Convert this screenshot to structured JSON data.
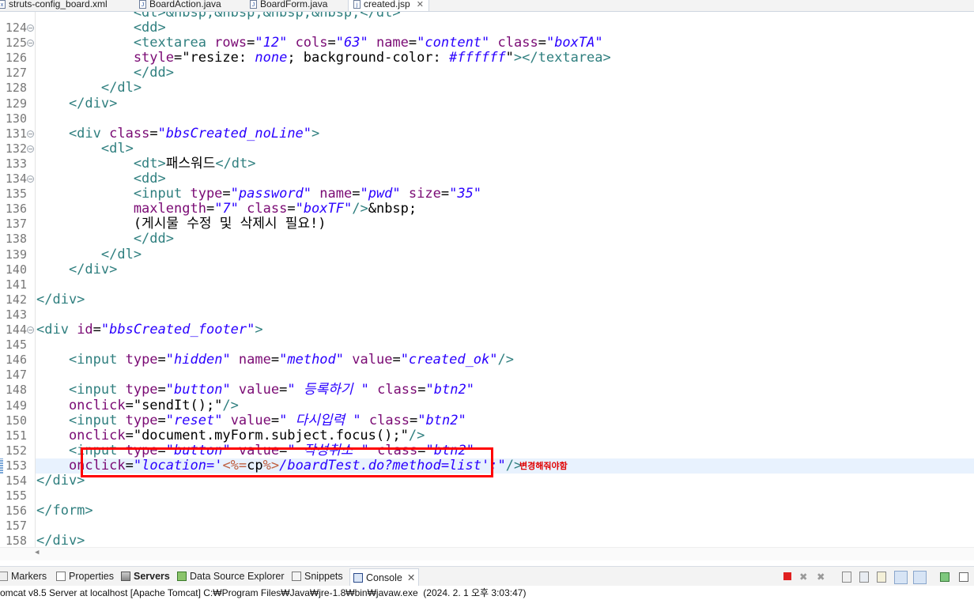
{
  "tabs": [
    {
      "label": "struts-config_board.xml",
      "icon": "xml-file-icon"
    },
    {
      "label": "BoardAction.java",
      "icon": "java-file-icon"
    },
    {
      "label": "BoardForm.java",
      "icon": "java-file-icon"
    },
    {
      "label": "created.jsp",
      "icon": "jsp-file-icon",
      "active": true
    }
  ],
  "editor": {
    "partial_top_line": "<dt>&nbsp;&nbsp;&nbsp;&nbsp;</dt>",
    "line_numbers": [
      "124",
      "125",
      "126",
      "127",
      "128",
      "129",
      "130",
      "131",
      "132",
      "133",
      "134",
      "135",
      "136",
      "137",
      "138",
      "139",
      "140",
      "141",
      "142",
      "143",
      "144",
      "145",
      "146",
      "147",
      "148",
      "149",
      "150",
      "151",
      "152",
      "153",
      "154",
      "155",
      "156",
      "157",
      "158"
    ],
    "lines": [
      {
        "n": "124",
        "t": [
          [
            "tg",
            "            <dd>"
          ]
        ]
      },
      {
        "n": "125",
        "t": [
          [
            "tg",
            "            <textarea "
          ],
          [
            "at",
            "rows"
          ],
          [
            "tx",
            "="
          ],
          [
            "sv",
            "\"12\""
          ],
          [
            "at",
            " cols"
          ],
          [
            "tx",
            "="
          ],
          [
            "sv",
            "\"63\""
          ],
          [
            "at",
            " name"
          ],
          [
            "tx",
            "="
          ],
          [
            "sv",
            "\"content\""
          ],
          [
            "at",
            " class"
          ],
          [
            "tx",
            "="
          ],
          [
            "sv",
            "\"boxTA\""
          ]
        ]
      },
      {
        "n": "126",
        "t": [
          [
            "at",
            "            style"
          ],
          [
            "tx",
            "=\"resize: "
          ],
          [
            "sv",
            "none"
          ],
          [
            "tx",
            "; background-color: "
          ],
          [
            "sv",
            "#ffffff"
          ],
          [
            "tx",
            "\""
          ],
          [
            "tg",
            "></textarea>"
          ]
        ]
      },
      {
        "n": "127",
        "t": [
          [
            "tg",
            "            </dd>"
          ]
        ]
      },
      {
        "n": "128",
        "t": [
          [
            "tg",
            "        </dl>"
          ]
        ]
      },
      {
        "n": "129",
        "t": [
          [
            "tg",
            "    </div>"
          ]
        ]
      },
      {
        "n": "130",
        "t": []
      },
      {
        "n": "131",
        "t": [
          [
            "tg",
            "    <div "
          ],
          [
            "at",
            "class"
          ],
          [
            "tx",
            "="
          ],
          [
            "sv",
            "\"bbsCreated_noLine\""
          ],
          [
            "tg",
            ">"
          ]
        ]
      },
      {
        "n": "132",
        "t": [
          [
            "tg",
            "        <dl>"
          ]
        ]
      },
      {
        "n": "133",
        "t": [
          [
            "tg",
            "            <dt>"
          ],
          [
            "tx",
            "패스워드"
          ],
          [
            "tg",
            "</dt>"
          ]
        ]
      },
      {
        "n": "134",
        "t": [
          [
            "tg",
            "            <dd>"
          ]
        ]
      },
      {
        "n": "135",
        "t": [
          [
            "tg",
            "            <input "
          ],
          [
            "at",
            "type"
          ],
          [
            "tx",
            "="
          ],
          [
            "sv",
            "\"password\""
          ],
          [
            "at",
            " name"
          ],
          [
            "tx",
            "="
          ],
          [
            "sv",
            "\"pwd\""
          ],
          [
            "at",
            " size"
          ],
          [
            "tx",
            "="
          ],
          [
            "sv",
            "\"35\""
          ]
        ]
      },
      {
        "n": "136",
        "t": [
          [
            "at",
            "            maxlength"
          ],
          [
            "tx",
            "="
          ],
          [
            "sv",
            "\"7\""
          ],
          [
            "at",
            " class"
          ],
          [
            "tx",
            "="
          ],
          [
            "sv",
            "\"boxTF\""
          ],
          [
            "tg",
            "/>"
          ],
          [
            "tx",
            "&nbsp;"
          ]
        ]
      },
      {
        "n": "137",
        "t": [
          [
            "tx",
            "            (게시물 수정 및 삭제시 필요!)"
          ]
        ]
      },
      {
        "n": "138",
        "t": [
          [
            "tg",
            "            </dd>"
          ]
        ]
      },
      {
        "n": "139",
        "t": [
          [
            "tg",
            "        </dl>"
          ]
        ]
      },
      {
        "n": "140",
        "t": [
          [
            "tg",
            "    </div>"
          ]
        ]
      },
      {
        "n": "141",
        "t": []
      },
      {
        "n": "142",
        "t": [
          [
            "tg",
            "</div>"
          ]
        ]
      },
      {
        "n": "143",
        "t": []
      },
      {
        "n": "144",
        "t": [
          [
            "tg",
            "<div "
          ],
          [
            "at",
            "id"
          ],
          [
            "tx",
            "="
          ],
          [
            "sv",
            "\"bbsCreated_footer\""
          ],
          [
            "tg",
            ">"
          ]
        ]
      },
      {
        "n": "145",
        "t": []
      },
      {
        "n": "146",
        "t": [
          [
            "tg",
            "    <input "
          ],
          [
            "at",
            "type"
          ],
          [
            "tx",
            "="
          ],
          [
            "sv",
            "\"hidden\""
          ],
          [
            "at",
            " name"
          ],
          [
            "tx",
            "="
          ],
          [
            "sv",
            "\"method\""
          ],
          [
            "at",
            " value"
          ],
          [
            "tx",
            "="
          ],
          [
            "sv",
            "\"created_ok\""
          ],
          [
            "tg",
            "/>"
          ]
        ]
      },
      {
        "n": "147",
        "t": []
      },
      {
        "n": "148",
        "t": [
          [
            "tg",
            "    <input "
          ],
          [
            "at",
            "type"
          ],
          [
            "tx",
            "="
          ],
          [
            "sv",
            "\"button\""
          ],
          [
            "at",
            " value"
          ],
          [
            "tx",
            "="
          ],
          [
            "sv",
            "\" 등록하기 \""
          ],
          [
            "at",
            " class"
          ],
          [
            "tx",
            "="
          ],
          [
            "sv",
            "\"btn2\""
          ]
        ]
      },
      {
        "n": "149",
        "t": [
          [
            "at",
            "    onclick"
          ],
          [
            "tx",
            "=\"sendIt();\""
          ],
          [
            "tg",
            "/>"
          ]
        ]
      },
      {
        "n": "150",
        "t": [
          [
            "tg",
            "    <input "
          ],
          [
            "at",
            "type"
          ],
          [
            "tx",
            "="
          ],
          [
            "sv",
            "\"reset\""
          ],
          [
            "at",
            " value"
          ],
          [
            "tx",
            "="
          ],
          [
            "sv",
            "\" 다시입력 \""
          ],
          [
            "at",
            " class"
          ],
          [
            "tx",
            "="
          ],
          [
            "sv",
            "\"btn2\""
          ]
        ]
      },
      {
        "n": "151",
        "t": [
          [
            "at",
            "    onclick"
          ],
          [
            "tx",
            "=\"document.myForm.subject.focus();\""
          ],
          [
            "tg",
            "/>"
          ]
        ]
      },
      {
        "n": "152",
        "t": [
          [
            "tg",
            "    <input "
          ],
          [
            "at",
            "type"
          ],
          [
            "tx",
            "="
          ],
          [
            "sv",
            "\"button\""
          ],
          [
            "at",
            " value"
          ],
          [
            "tx",
            "="
          ],
          [
            "sv",
            "\" 작성취소 \""
          ],
          [
            "at",
            " class"
          ],
          [
            "tx",
            "="
          ],
          [
            "sv",
            "\"btn2\""
          ]
        ]
      },
      {
        "n": "153",
        "t": [
          [
            "at",
            "    onclick"
          ],
          [
            "tx",
            "="
          ],
          [
            "sv",
            "\"location='"
          ],
          [
            "jsp",
            "<%="
          ],
          [
            "tx",
            "cp"
          ],
          [
            "jsp",
            "%>"
          ],
          [
            "sv",
            "/boardTest.do?method=list';\""
          ],
          [
            "tg",
            "/>"
          ]
        ]
      },
      {
        "n": "154",
        "t": [
          [
            "tg",
            "</div>"
          ]
        ]
      },
      {
        "n": "155",
        "t": []
      },
      {
        "n": "156",
        "t": [
          [
            "tg",
            "</form>"
          ]
        ]
      },
      {
        "n": "157",
        "t": []
      },
      {
        "n": "158",
        "t": [
          [
            "tg",
            "</div>"
          ]
        ]
      }
    ],
    "fold_lines": [
      "124",
      "125",
      "131",
      "132",
      "134",
      "144"
    ],
    "current_line": "153"
  },
  "annotation": {
    "note": "변경해줘야함"
  },
  "panel": {
    "tabs": [
      {
        "label": "Markers"
      },
      {
        "label": "Properties"
      },
      {
        "label": "Servers"
      },
      {
        "label": "Data Source Explorer"
      },
      {
        "label": "Snippets"
      },
      {
        "label": "Console"
      }
    ],
    "close": "✕",
    "status": "omcat v8.5 Server at localhost [Apache Tomcat] C:₩Program Files₩Java₩jre-1.8₩bin₩javaw.exe  (2024. 2. 1 오후 3:03:47)"
  }
}
